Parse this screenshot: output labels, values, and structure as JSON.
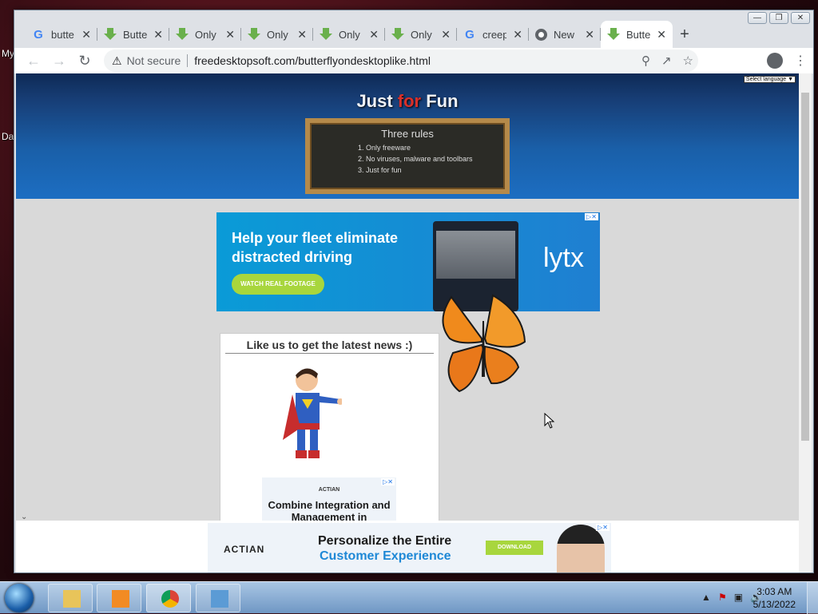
{
  "desktop": {
    "labels": [
      "My",
      "Da"
    ]
  },
  "window": {
    "controls": [
      "minimize",
      "restore",
      "close"
    ]
  },
  "tabs": [
    {
      "icon": "google-icon",
      "title": "butte"
    },
    {
      "icon": "download-icon",
      "title": "Butte"
    },
    {
      "icon": "download-icon",
      "title": "Only"
    },
    {
      "icon": "download-icon",
      "title": "Only"
    },
    {
      "icon": "download-icon",
      "title": "Only"
    },
    {
      "icon": "download-icon",
      "title": "Only"
    },
    {
      "icon": "google-icon",
      "title": "creep"
    },
    {
      "icon": "chrome-icon",
      "title": "New"
    },
    {
      "icon": "download-icon",
      "title": "Butte",
      "active": true
    }
  ],
  "toolbar": {
    "security": "Not secure",
    "url": "freedesktopsoft.com/butterflyondesktoplike.html"
  },
  "page": {
    "logo_a": "Just ",
    "logo_for": "for",
    "logo_b": " Fun",
    "lang_select": "Select language",
    "rules_title": "Three rules",
    "rules": [
      "Only freeware",
      "No viruses, malware and toolbars",
      "Just for fun"
    ],
    "ad1": {
      "headline": "Help your fleet eliminate distracted driving",
      "button": "WATCH REAL FOOTAGE",
      "brand": "lytx"
    },
    "like_title": "Like us to get the latest news :)",
    "ad2": {
      "brand": "ACTIAN",
      "text": "Combine Integration and Management in"
    },
    "ad3": {
      "brand": "ACTIAN",
      "line1": "Personalize the Entire",
      "line2": "Customer Experience",
      "button": "DOWNLOAD"
    }
  },
  "taskbar": {
    "time": "3:03 AM",
    "date": "5/13/2022"
  }
}
